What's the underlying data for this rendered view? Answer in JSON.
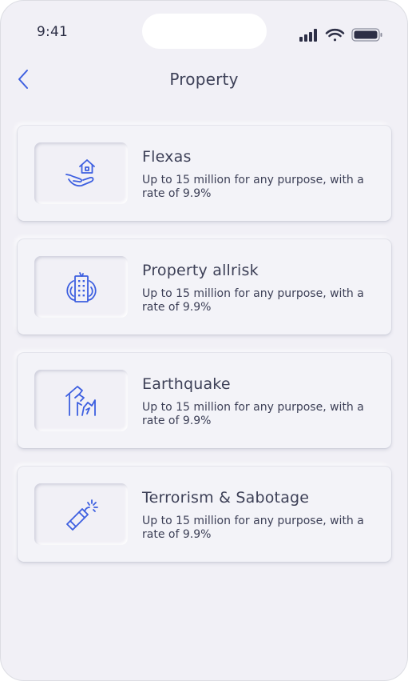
{
  "status_bar": {
    "time": "9:41"
  },
  "header": {
    "back_icon": "chevron-left-icon",
    "title": "Property"
  },
  "colors": {
    "accent": "#3d5fe0",
    "text": "#3d4057",
    "background": "#f1f0f6"
  },
  "cards": [
    {
      "icon": "hand-house-icon",
      "title": "Flexas",
      "description": "Up to 15 million for any purpose, with a rate of 9.9%"
    },
    {
      "icon": "building-fire-icon",
      "title": "Property allrisk",
      "description": "Up to 15 million for any purpose, with a rate of 9.9%"
    },
    {
      "icon": "cracked-house-icon",
      "title": "Earthquake",
      "description": "Up to 15 million for any purpose, with a rate of 9.9%"
    },
    {
      "icon": "dynamite-icon",
      "title": "Terrorism & Sabotage",
      "description": "Up to 15 million for any purpose, with a rate of 9.9%"
    }
  ]
}
